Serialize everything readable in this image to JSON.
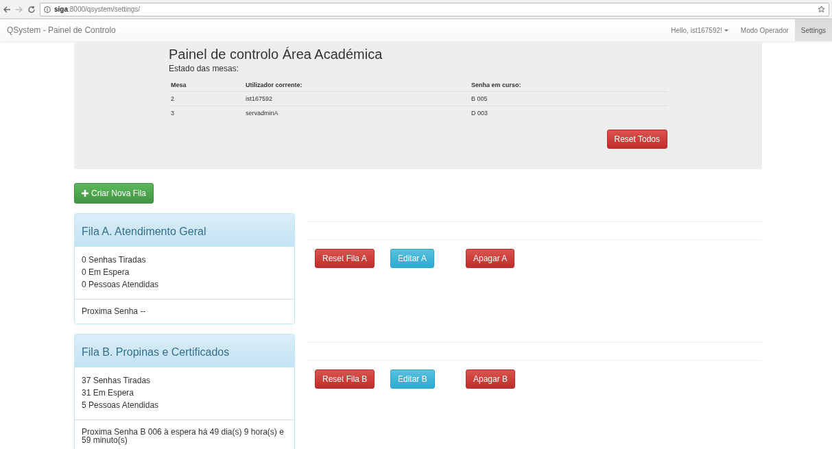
{
  "browser": {
    "url": "**siga**:8000/qsystem/settings/"
  },
  "navbar": {
    "brand": "QSystem - Painel de Controlo",
    "items": [
      {
        "label": "Hello, ist167592!",
        "kind": "dropdown",
        "selected": false
      },
      {
        "label": "Modo Operador",
        "kind": "link",
        "selected": false
      },
      {
        "label": "Settings",
        "kind": "link",
        "selected": true
      }
    ]
  },
  "control_panel": {
    "title": "Painel de controlo Área Académica",
    "subtitle": "Estado das mesas:",
    "table": {
      "columns": [
        "Mesa",
        "Utilizador corrente:",
        "Senha em curso:"
      ],
      "rows": [
        [
          "2",
          "ist167592",
          "B 005"
        ],
        [
          "3",
          "servadminA",
          "D 003"
        ]
      ]
    },
    "reset_button": "Reset Todos"
  },
  "create_button": "Criar Nova Fila",
  "queues": [
    {
      "title": "Fila A. Atendimento Geral",
      "stats": [
        "0 Senhas Tiradas",
        "0 Em Espera",
        "0 Pessoas Atendidas"
      ],
      "next": "Proxima Senha --",
      "buttons": [
        {
          "label": "Reset Fila A",
          "kind": "danger"
        },
        {
          "label": "Editar A",
          "kind": "info"
        },
        {
          "label": "Apagar A",
          "kind": "danger"
        }
      ]
    },
    {
      "title": "Fila B. Propinas e Certificados",
      "stats": [
        "37 Senhas Tiradas",
        "31 Em Espera",
        "5 Pessoas Atendidas"
      ],
      "next": "Proxima Senha B 006 à espera há 49 dia(s) 9 hora(s) e 59 minuto(s)",
      "buttons": [
        {
          "label": "Reset Fila B",
          "kind": "danger"
        },
        {
          "label": "Editar B",
          "kind": "info"
        },
        {
          "label": "Apagar B",
          "kind": "danger"
        }
      ]
    }
  ]
}
